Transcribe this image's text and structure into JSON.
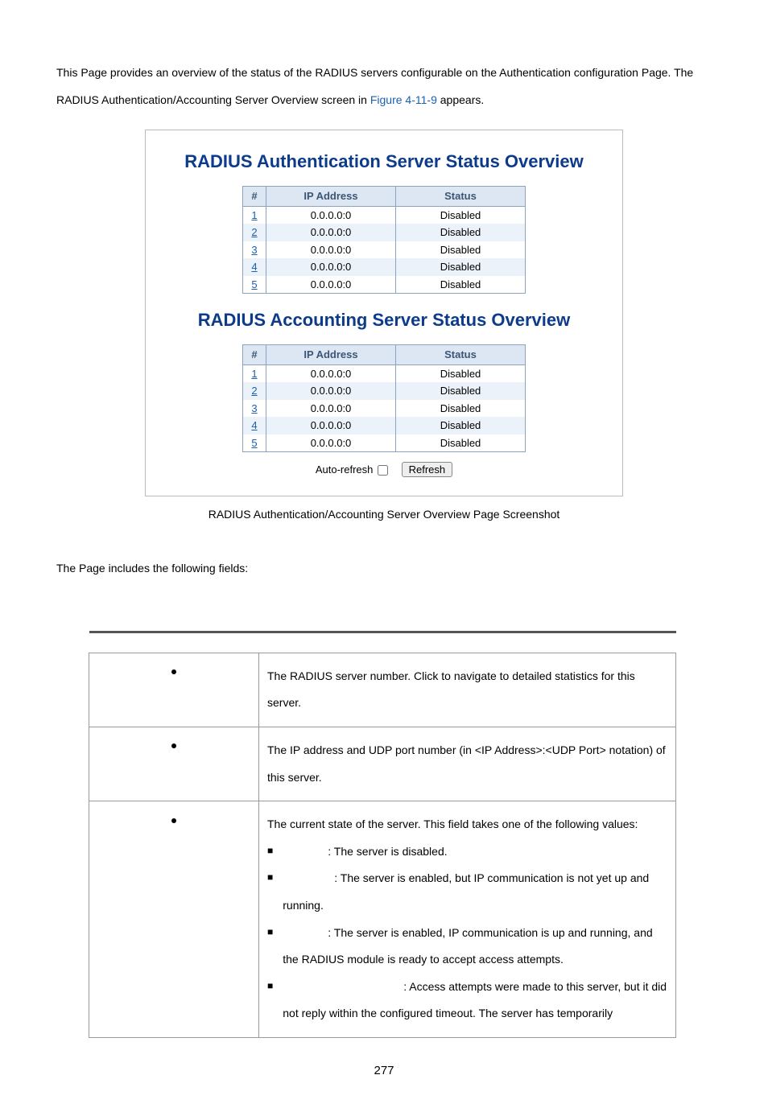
{
  "intro": {
    "part1": "This Page provides an overview of the status of the RADIUS servers configurable on the Authentication configuration Page. The RADIUS Authentication/Accounting Server Overview screen in ",
    "figlink": "Figure 4-11-9",
    "part2": " appears."
  },
  "figure": {
    "title1": "RADIUS Authentication Server Status Overview",
    "title2": "RADIUS Accounting Server Status Overview",
    "headers": {
      "num": "#",
      "ip": "IP Address",
      "status": "Status"
    },
    "rows": [
      {
        "n": "1",
        "ip": "0.0.0.0:0",
        "status": "Disabled"
      },
      {
        "n": "2",
        "ip": "0.0.0.0:0",
        "status": "Disabled"
      },
      {
        "n": "3",
        "ip": "0.0.0.0:0",
        "status": "Disabled"
      },
      {
        "n": "4",
        "ip": "0.0.0.0:0",
        "status": "Disabled"
      },
      {
        "n": "5",
        "ip": "0.0.0.0:0",
        "status": "Disabled"
      }
    ],
    "autorefresh_label": "Auto-refresh",
    "refresh_btn": "Refresh"
  },
  "caption": "RADIUS Authentication/Accounting Server Overview Page Screenshot",
  "fields_intro": "The Page includes the following fields:",
  "field_desc": {
    "num": "The RADIUS server number. Click to navigate to detailed statistics for this server.",
    "ip": "The IP address and UDP port number (in <IP Address>:<UDP Port> notation) of this server.",
    "status_intro": "The current state of the server. This field takes one of the following values:",
    "disabled": ": The server is disabled.",
    "notready": ": The server is enabled, but IP communication is not yet up and running.",
    "ready": ": The server is enabled, IP communication is up and running, and the RADIUS module is ready to accept access attempts.",
    "dead": ": Access attempts were made to this server, but it did not reply within the configured timeout. The server has temporarily"
  },
  "page_number": "277"
}
